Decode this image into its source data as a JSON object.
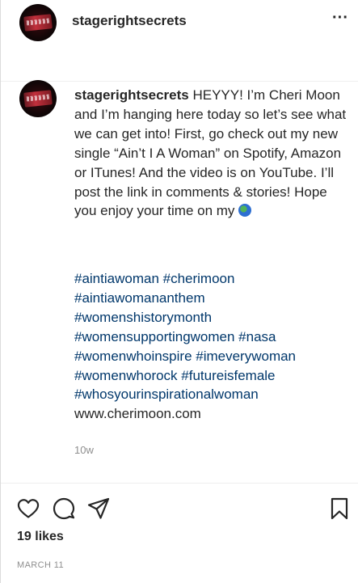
{
  "header": {
    "username": "stagerightsecrets",
    "more_icon": "more-options-icon",
    "more_glyph": "···"
  },
  "caption": {
    "username": "stagerightsecrets",
    "text": "HEYYY! I’m Cheri Moon and I’m hanging here today so let’s see what we can get into! First, go check out my new single “Ain’t I A Woman” on Spotify, Amazon or ITunes! And the video is on YouTube. I’ll post the link in comments & stories! Hope you enjoy your time on my",
    "emoji": "globe-emoji",
    "hashtags": [
      "#aintiawoman #cherimoon",
      "#aintiawomananthem",
      "#womenshistorymonth",
      "#womensupportingwomen #nasa",
      "#womenwhoinspire #imeverywoman",
      "#womenwhorock #futureisfemale",
      "#whosyourinspirationalwoman"
    ],
    "website": "www.cherimoon.com",
    "time": "10w"
  },
  "actions": {
    "icons": [
      "heart-icon",
      "comment-icon",
      "share-icon",
      "bookmark-icon"
    ],
    "likes": "19 likes",
    "date": "MARCH 11"
  }
}
